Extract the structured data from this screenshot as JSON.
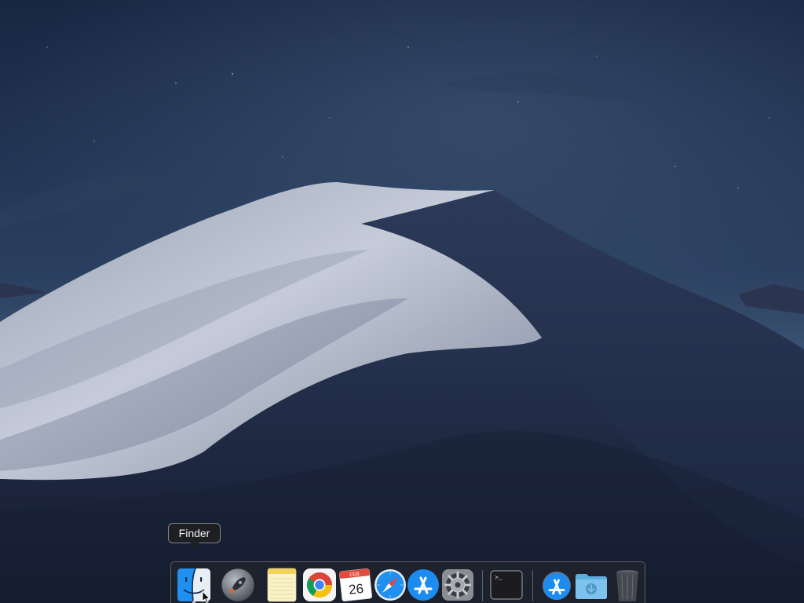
{
  "screen": {
    "wallpaper": "mojave-night-dune"
  },
  "tooltip": {
    "text": "Finder"
  },
  "dock": {
    "items": [
      {
        "name": "Finder",
        "icon": "finder-icon",
        "running": true
      },
      {
        "name": "Launchpad",
        "icon": "launchpad-rocket-icon"
      },
      {
        "name": "Notes",
        "icon": "notes-icon"
      },
      {
        "name": "Google Chrome",
        "icon": "chrome-icon"
      },
      {
        "name": "Calendar",
        "icon": "calendar-icon",
        "month": "FEB",
        "day": "26"
      },
      {
        "name": "Safari",
        "icon": "safari-compass-icon"
      },
      {
        "name": "App Store",
        "icon": "app-store-icon"
      },
      {
        "name": "System Preferences",
        "icon": "gear-icon"
      },
      {
        "name": "Terminal",
        "icon": "terminal-icon",
        "prompt": ">_"
      },
      {
        "name": "Applications",
        "icon": "app-store-stack-icon"
      },
      {
        "name": "Downloads",
        "icon": "downloads-folder-icon"
      },
      {
        "name": "Trash",
        "icon": "trash-icon"
      }
    ]
  },
  "colors": {
    "sky_top": "#1a2b4a",
    "sky_bottom": "#3a5070",
    "dune_light": "#b7bfcf",
    "dune_shadow": "#1e2a45",
    "dock_bg": "#20242c",
    "accent_blue": "#1f8ff0"
  }
}
